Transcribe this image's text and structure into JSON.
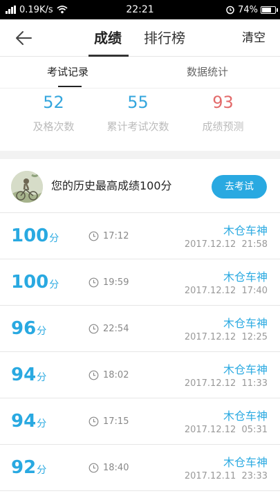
{
  "status_bar": {
    "network_speed": "0.19K/s",
    "time": "22:21",
    "battery": "74%",
    "battery_level": 0.74,
    "icons": [
      "signal-icon",
      "wifi-icon",
      "alarm-icon",
      "battery-icon"
    ]
  },
  "header": {
    "tabs": [
      {
        "label": "成绩",
        "active": true
      },
      {
        "label": "排行榜",
        "active": false
      }
    ],
    "clear_label": "清空"
  },
  "subtabs": [
    {
      "label": "考试记录",
      "active": true
    },
    {
      "label": "数据统计",
      "active": false
    }
  ],
  "stats": [
    {
      "value": "52",
      "label": "及格次数",
      "color": "#34a6dd"
    },
    {
      "value": "55",
      "label": "累计考试次数",
      "color": "#34a6dd"
    },
    {
      "value": "93",
      "label": "成绩预测",
      "color": "#e36b6b"
    }
  ],
  "best": {
    "text": "您的历史最高成绩100分",
    "button_label": "去考试"
  },
  "records": [
    {
      "score": "100",
      "unit": "分",
      "duration": "17:12",
      "name": "木仓车神",
      "date": "2017.12.12  21:58"
    },
    {
      "score": "100",
      "unit": "分",
      "duration": "19:59",
      "name": "木仓车神",
      "date": "2017.12.12  17:40"
    },
    {
      "score": "96",
      "unit": "分",
      "duration": "22:54",
      "name": "木仓车神",
      "date": "2017.12.12  12:25"
    },
    {
      "score": "94",
      "unit": "分",
      "duration": "18:02",
      "name": "木仓车神",
      "date": "2017.12.12  11:33"
    },
    {
      "score": "94",
      "unit": "分",
      "duration": "17:15",
      "name": "木仓车神",
      "date": "2017.12.12  05:31"
    },
    {
      "score": "92",
      "unit": "分",
      "duration": "18:40",
      "name": "木仓车神",
      "date": "2017.12.11  23:33"
    }
  ],
  "colors": {
    "accent": "#29a9e1",
    "prediction": "#e36b6b"
  }
}
